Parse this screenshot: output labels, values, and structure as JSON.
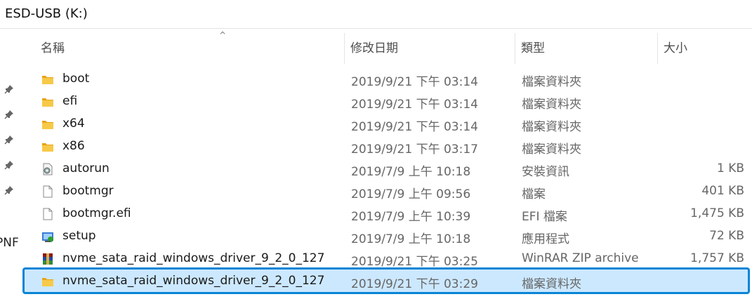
{
  "window": {
    "title": "ESD-USB (K:)"
  },
  "nav": {
    "partial_label": "PNF"
  },
  "columns": {
    "name": "名稱",
    "date": "修改日期",
    "type": "類型",
    "size": "大小"
  },
  "files": [
    {
      "name": "boot",
      "date": "2019/9/21 下午 03:14",
      "type": "檔案資料夾",
      "size": "",
      "icon": "folder-icon"
    },
    {
      "name": "efi",
      "date": "2019/9/21 下午 03:14",
      "type": "檔案資料夾",
      "size": "",
      "icon": "folder-icon"
    },
    {
      "name": "x64",
      "date": "2019/9/21 下午 03:14",
      "type": "檔案資料夾",
      "size": "",
      "icon": "folder-icon"
    },
    {
      "name": "x86",
      "date": "2019/9/21 下午 03:17",
      "type": "檔案資料夾",
      "size": "",
      "icon": "folder-icon"
    },
    {
      "name": "autorun",
      "date": "2019/7/9 上午 10:18",
      "type": "安裝資訊",
      "size": "1 KB",
      "icon": "setup-info-icon"
    },
    {
      "name": "bootmgr",
      "date": "2019/7/9 上午 09:56",
      "type": "檔案",
      "size": "401 KB",
      "icon": "file-icon"
    },
    {
      "name": "bootmgr.efi",
      "date": "2019/7/9 上午 10:39",
      "type": "EFI 檔案",
      "size": "1,475 KB",
      "icon": "file-icon"
    },
    {
      "name": "setup",
      "date": "2019/7/9 上午 10:18",
      "type": "應用程式",
      "size": "72 KB",
      "icon": "setup-app-icon"
    },
    {
      "name": "nvme_sata_raid_windows_driver_9_2_0_127",
      "date": "2019/9/21 下午 03:25",
      "type": "WinRAR ZIP archive",
      "size": "1,757 KB",
      "icon": "winrar-archive-icon"
    },
    {
      "name": "nvme_sata_raid_windows_driver_9_2_0_127",
      "date": "2019/9/21 下午 03:29",
      "type": "檔案資料夾",
      "size": "",
      "icon": "folder-icon",
      "selected": true
    }
  ],
  "colors": {
    "selection_fill": "#cce8ff",
    "selection_border": "#0a84d6",
    "folder": "#f4c14b"
  }
}
